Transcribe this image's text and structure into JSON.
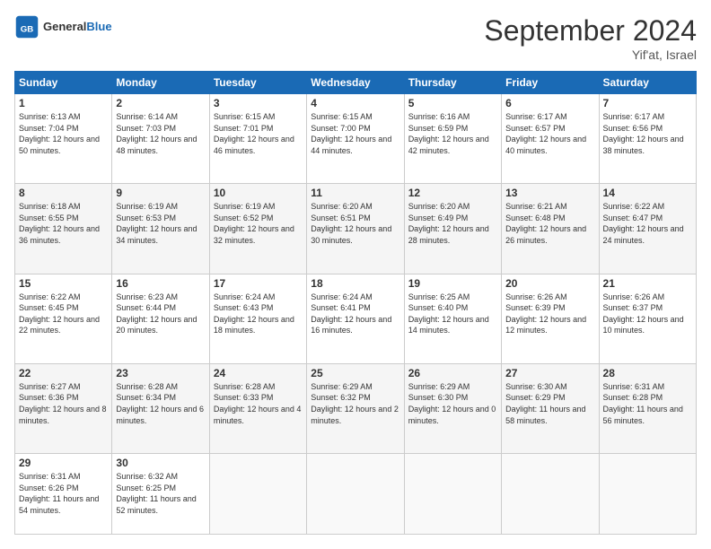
{
  "logo": {
    "text_general": "General",
    "text_blue": "Blue"
  },
  "title": "September 2024",
  "location": "Yif'at, Israel",
  "days_of_week": [
    "Sunday",
    "Monday",
    "Tuesday",
    "Wednesday",
    "Thursday",
    "Friday",
    "Saturday"
  ],
  "weeks": [
    [
      {
        "day": 1,
        "sunrise": "6:13 AM",
        "sunset": "7:04 PM",
        "daylight": "12 hours and 50 minutes."
      },
      {
        "day": 2,
        "sunrise": "6:14 AM",
        "sunset": "7:03 PM",
        "daylight": "12 hours and 48 minutes."
      },
      {
        "day": 3,
        "sunrise": "6:15 AM",
        "sunset": "7:01 PM",
        "daylight": "12 hours and 46 minutes."
      },
      {
        "day": 4,
        "sunrise": "6:15 AM",
        "sunset": "7:00 PM",
        "daylight": "12 hours and 44 minutes."
      },
      {
        "day": 5,
        "sunrise": "6:16 AM",
        "sunset": "6:59 PM",
        "daylight": "12 hours and 42 minutes."
      },
      {
        "day": 6,
        "sunrise": "6:17 AM",
        "sunset": "6:57 PM",
        "daylight": "12 hours and 40 minutes."
      },
      {
        "day": 7,
        "sunrise": "6:17 AM",
        "sunset": "6:56 PM",
        "daylight": "12 hours and 38 minutes."
      }
    ],
    [
      {
        "day": 8,
        "sunrise": "6:18 AM",
        "sunset": "6:55 PM",
        "daylight": "12 hours and 36 minutes."
      },
      {
        "day": 9,
        "sunrise": "6:19 AM",
        "sunset": "6:53 PM",
        "daylight": "12 hours and 34 minutes."
      },
      {
        "day": 10,
        "sunrise": "6:19 AM",
        "sunset": "6:52 PM",
        "daylight": "12 hours and 32 minutes."
      },
      {
        "day": 11,
        "sunrise": "6:20 AM",
        "sunset": "6:51 PM",
        "daylight": "12 hours and 30 minutes."
      },
      {
        "day": 12,
        "sunrise": "6:20 AM",
        "sunset": "6:49 PM",
        "daylight": "12 hours and 28 minutes."
      },
      {
        "day": 13,
        "sunrise": "6:21 AM",
        "sunset": "6:48 PM",
        "daylight": "12 hours and 26 minutes."
      },
      {
        "day": 14,
        "sunrise": "6:22 AM",
        "sunset": "6:47 PM",
        "daylight": "12 hours and 24 minutes."
      }
    ],
    [
      {
        "day": 15,
        "sunrise": "6:22 AM",
        "sunset": "6:45 PM",
        "daylight": "12 hours and 22 minutes."
      },
      {
        "day": 16,
        "sunrise": "6:23 AM",
        "sunset": "6:44 PM",
        "daylight": "12 hours and 20 minutes."
      },
      {
        "day": 17,
        "sunrise": "6:24 AM",
        "sunset": "6:43 PM",
        "daylight": "12 hours and 18 minutes."
      },
      {
        "day": 18,
        "sunrise": "6:24 AM",
        "sunset": "6:41 PM",
        "daylight": "12 hours and 16 minutes."
      },
      {
        "day": 19,
        "sunrise": "6:25 AM",
        "sunset": "6:40 PM",
        "daylight": "12 hours and 14 minutes."
      },
      {
        "day": 20,
        "sunrise": "6:26 AM",
        "sunset": "6:39 PM",
        "daylight": "12 hours and 12 minutes."
      },
      {
        "day": 21,
        "sunrise": "6:26 AM",
        "sunset": "6:37 PM",
        "daylight": "12 hours and 10 minutes."
      }
    ],
    [
      {
        "day": 22,
        "sunrise": "6:27 AM",
        "sunset": "6:36 PM",
        "daylight": "12 hours and 8 minutes."
      },
      {
        "day": 23,
        "sunrise": "6:28 AM",
        "sunset": "6:34 PM",
        "daylight": "12 hours and 6 minutes."
      },
      {
        "day": 24,
        "sunrise": "6:28 AM",
        "sunset": "6:33 PM",
        "daylight": "12 hours and 4 minutes."
      },
      {
        "day": 25,
        "sunrise": "6:29 AM",
        "sunset": "6:32 PM",
        "daylight": "12 hours and 2 minutes."
      },
      {
        "day": 26,
        "sunrise": "6:29 AM",
        "sunset": "6:30 PM",
        "daylight": "12 hours and 0 minutes."
      },
      {
        "day": 27,
        "sunrise": "6:30 AM",
        "sunset": "6:29 PM",
        "daylight": "11 hours and 58 minutes."
      },
      {
        "day": 28,
        "sunrise": "6:31 AM",
        "sunset": "6:28 PM",
        "daylight": "11 hours and 56 minutes."
      }
    ],
    [
      {
        "day": 29,
        "sunrise": "6:31 AM",
        "sunset": "6:26 PM",
        "daylight": "11 hours and 54 minutes."
      },
      {
        "day": 30,
        "sunrise": "6:32 AM",
        "sunset": "6:25 PM",
        "daylight": "11 hours and 52 minutes."
      },
      null,
      null,
      null,
      null,
      null
    ]
  ]
}
